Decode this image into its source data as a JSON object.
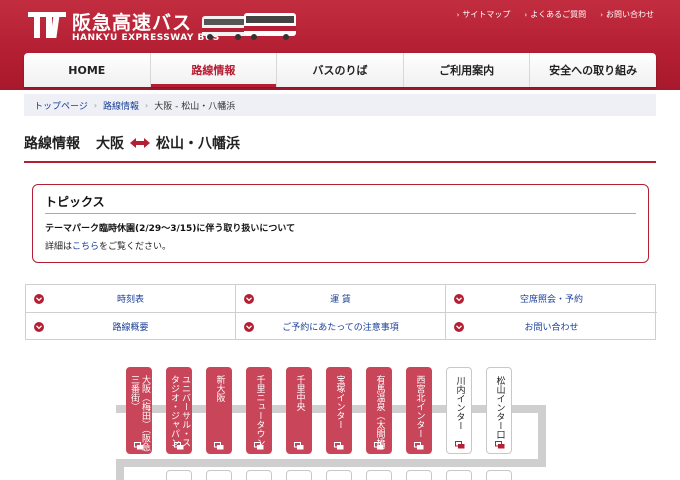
{
  "header": {
    "logo_jp": "阪急高速バス",
    "logo_en": "HANKYU EXPRESSWAY BUS",
    "utility_links": [
      {
        "label": "サイトマップ"
      },
      {
        "label": "よくあるご質問"
      },
      {
        "label": "お問い合わせ"
      }
    ]
  },
  "nav": {
    "items": [
      {
        "label": "HOME"
      },
      {
        "label": "路線情報"
      },
      {
        "label": "バスのりば"
      },
      {
        "label": "ご利用案内"
      },
      {
        "label": "安全への取り組み"
      }
    ],
    "active_index": 1
  },
  "breadcrumb": {
    "items": [
      "トップページ",
      "路線情報"
    ],
    "current": "大阪 - 松山・八幡浜"
  },
  "page_title": {
    "label": "路線情報",
    "from": "大阪",
    "to": "松山・八幡浜"
  },
  "topics": {
    "heading": "トピックス",
    "line": "テーマパーク臨時休園(2/29〜3/15)に伴う取り扱いについて",
    "detail_prefix": "詳細は",
    "detail_link": "こちら",
    "detail_suffix": "をご覧ください。"
  },
  "menu": {
    "items": [
      {
        "label": "時刻表"
      },
      {
        "label": "運 賃"
      },
      {
        "label": "空席照会・予約"
      },
      {
        "label": "路線概要"
      },
      {
        "label": "ご予約にあたっての注意事項"
      },
      {
        "label": "お問い合わせ"
      }
    ]
  },
  "stops": {
    "items": [
      {
        "name": "大阪（梅田）（阪急三番街）",
        "style": "red"
      },
      {
        "name": "ユニバーサル・スタジオ・ジャパン",
        "style": "red"
      },
      {
        "name": "新大阪",
        "style": "red"
      },
      {
        "name": "千里ニュータウン",
        "style": "red"
      },
      {
        "name": "千里中央",
        "style": "red"
      },
      {
        "name": "宝塚インター",
        "style": "red"
      },
      {
        "name": "有馬温泉（太閤橋）",
        "style": "red"
      },
      {
        "name": "西宮北インター",
        "style": "red"
      },
      {
        "name": "川内インター",
        "style": "white"
      },
      {
        "name": "松山インター口",
        "style": "white"
      }
    ]
  },
  "colors": {
    "brand_red": "#b51f33",
    "link_blue": "#1a3f99",
    "stop_red": "#c9465a"
  }
}
